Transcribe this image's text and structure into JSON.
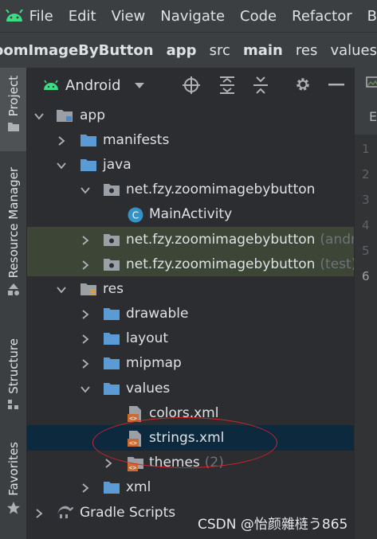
{
  "menubar": {
    "items": [
      "File",
      "Edit",
      "View",
      "Navigate",
      "Code",
      "Refactor",
      "B"
    ]
  },
  "breadcrumb": [
    "oomImageByButton",
    "app",
    "src",
    "main",
    "res",
    "values"
  ],
  "toolstrip": {
    "tabs": [
      "Project",
      "Resource Manager",
      "Structure",
      "Favorites"
    ]
  },
  "panel": {
    "view_mode": "Android"
  },
  "tree": [
    {
      "label": "app",
      "suffix": "",
      "icon": "module-folder-icon",
      "state": "expanded"
    },
    {
      "label": "manifests",
      "suffix": "",
      "icon": "folder-icon",
      "state": "collapsed"
    },
    {
      "label": "java",
      "suffix": "",
      "icon": "folder-icon",
      "state": "expanded"
    },
    {
      "label": "net.fzy.zoomimagebybutton",
      "suffix": "",
      "icon": "package-icon",
      "state": "expanded"
    },
    {
      "label": "MainActivity",
      "suffix": "",
      "icon": "class-icon",
      "state": "leaf"
    },
    {
      "label": "net.fzy.zoomimagebybutton",
      "suffix": "(andro",
      "icon": "package-icon",
      "state": "collapsed"
    },
    {
      "label": "net.fzy.zoomimagebybutton",
      "suffix": "(test)",
      "icon": "package-icon",
      "state": "collapsed"
    },
    {
      "label": "res",
      "suffix": "",
      "icon": "res-folder-icon",
      "state": "expanded"
    },
    {
      "label": "drawable",
      "suffix": "",
      "icon": "folder-icon",
      "state": "collapsed"
    },
    {
      "label": "layout",
      "suffix": "",
      "icon": "folder-icon",
      "state": "collapsed"
    },
    {
      "label": "mipmap",
      "suffix": "",
      "icon": "folder-icon",
      "state": "collapsed"
    },
    {
      "label": "values",
      "suffix": "",
      "icon": "folder-icon",
      "state": "expanded"
    },
    {
      "label": "colors.xml",
      "suffix": "",
      "icon": "xml-file-icon",
      "state": "leaf"
    },
    {
      "label": "strings.xml",
      "suffix": "",
      "icon": "xml-file-icon",
      "state": "leaf"
    },
    {
      "label": "themes",
      "suffix": "(2)",
      "icon": "xml-folder-icon",
      "state": "collapsed"
    },
    {
      "label": "xml",
      "suffix": "",
      "icon": "folder-icon",
      "state": "collapsed"
    },
    {
      "label": "Gradle Scripts",
      "suffix": "",
      "icon": "gradle-icon",
      "state": "collapsed"
    }
  ],
  "editor": {
    "tab_label": "E",
    "line_numbers": [
      "1",
      "2",
      "3",
      "4",
      "5",
      "6"
    ]
  },
  "watermark": "CSDN @怡颜雜梿う865",
  "colors": {
    "selection": "#0d293e",
    "highlight": "#3d4536",
    "android_green": "#3ddc84",
    "folder_blue": "#5a9bd5",
    "annotation_red": "#d0242b"
  }
}
